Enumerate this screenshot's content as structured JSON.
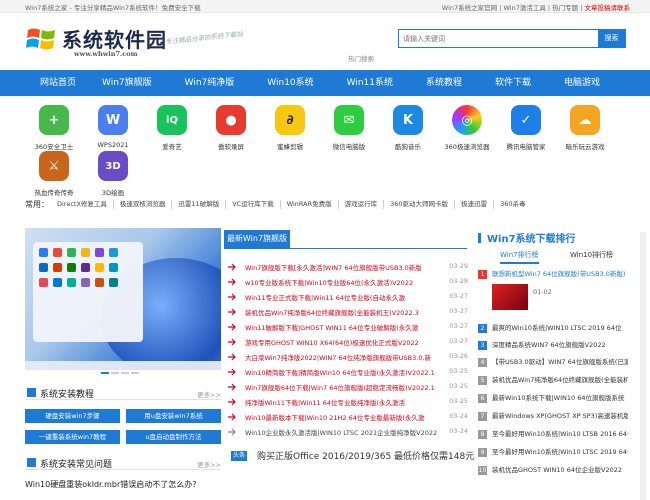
{
  "topbar": {
    "left": "Win7系统之家 - 专注分享精品Win7系统软件！免费安全下载",
    "right_links": [
      "Win7系统之家官网",
      "Win7激活工具",
      "热门专题"
    ],
    "right_red": "文章投稿请联系"
  },
  "logo": {
    "text": "系统软件园",
    "url": "www.whwin7.com",
    "slogan": "专注精品分享的系统下载站"
  },
  "search": {
    "placeholder": "请输入关键词",
    "button": "搜索",
    "hot_label": "热门搜索"
  },
  "nav": [
    "网站首页",
    "Win7旗舰版",
    "Win7纯净版",
    "Win10系统",
    "Win11系统",
    "系统教程",
    "软件下载",
    "电脑游戏"
  ],
  "apps": [
    {
      "name": "360安全卫士",
      "color": "#49b749",
      "glyph": "+"
    },
    {
      "name": "WPS2021",
      "color": "#4b7ff0",
      "glyph": "W"
    },
    {
      "name": "爱奇艺",
      "color": "#19c25a",
      "glyph": "iQ"
    },
    {
      "name": "傲软录屏",
      "color": "#e63b2e",
      "glyph": "●"
    },
    {
      "name": "蜜蜂剪辑",
      "color": "#f7c812",
      "glyph": "∂"
    },
    {
      "name": "微信电脑版",
      "color": "#2ecc40",
      "glyph": "✉"
    },
    {
      "name": "酷狗音乐",
      "color": "#1e88e5",
      "glyph": "K"
    },
    {
      "name": "360极速浏览器",
      "color": "#ff8a1c",
      "glyph": "◎"
    },
    {
      "name": "腾讯电脑管家",
      "color": "#1d7fe8",
      "glyph": "✓"
    },
    {
      "name": "暗乐玩云游戏",
      "color": "#f4a623",
      "glyph": "☁"
    },
    {
      "name": "热血传奇传奇",
      "color": "#c9641b",
      "glyph": "⚔"
    },
    {
      "name": "3D绘画",
      "color": "#6a4cc7",
      "glyph": "3D"
    }
  ],
  "tags": {
    "label": "常用：",
    "items": [
      "DirectX修复工具",
      "极速双核浏览器",
      "迅雷11破解版",
      "VC运行库下载",
      "WinRAR免费版",
      "游戏运行库",
      "360驱动大师网卡版",
      "极速迅雷",
      "360杀毒"
    ]
  },
  "install_section": {
    "title": "系统安装教程",
    "more": "更多>>",
    "buttons": [
      "硬盘安装win7步骤",
      "用u盘安装win7系统",
      "一键重装系统win7教程",
      "u盘启动盘制作方法"
    ]
  },
  "faq_section": {
    "title": "系统安装常见问题",
    "more": "更多>>",
    "first_item": "Win10硬盘重装okldr.mbr错误启动不了怎么办?"
  },
  "news": {
    "title": "最新Win7旗舰版",
    "items": [
      {
        "text": "Win7旗舰版下载[永久激活]WIN7 64位旗舰版带USB3.0新版",
        "date": "03-29",
        "red": true
      },
      {
        "text": "w10专业版系统下载|Win10专业版64位(永久激活)V2022",
        "date": "03-28",
        "red": true
      },
      {
        "text": "Win11专业正式版下载|Win11 64位专业版(自动永久激",
        "date": "03-27",
        "red": true
      },
      {
        "text": "装机优品Win7纯净版64位终藏旗舰版(全能装机王)V2022.3",
        "date": "03-27",
        "red": true
      },
      {
        "text": "Win11破解版下载|GHOST WIN11 64位专业破解版(永久激",
        "date": "03-27",
        "red": true
      },
      {
        "text": "游戏专用GHOST WIN10 X64(64位)极速优化正式版V2022",
        "date": "03-27",
        "red": true
      },
      {
        "text": "大白菜Win7纯净版2022|WIN7 64位纯净版旗舰版带USB3.0,新",
        "date": "03-26",
        "red": true
      },
      {
        "text": "Win10精简版下载|精简版Win10 64位专业版(永久激活)V2022.1",
        "date": "03-25",
        "red": true
      },
      {
        "text": "Win7旗舰版64位下载|Win7 64位旗舰版(超稳定流畅版)V2022.1",
        "date": "03-25",
        "red": true
      },
      {
        "text": "纯净版Win11下载|Win11 64位专业版纯净版(永久激活",
        "date": "03-25",
        "red": true
      },
      {
        "text": "Win10最新版本下载|Win10 21H2 64位专业版最新版(永久激",
        "date": "03-24",
        "red": true
      },
      {
        "text": "Win10企业版永久激活版|WIN10 LTSC 2021企业版纯净版V2022",
        "date": "03-24",
        "red": false
      }
    ]
  },
  "ad": {
    "label": "头条",
    "text": "购买正版Office 2016/2019/365 最低价格仅需148元"
  },
  "rank": {
    "title": "Win7系统下载排行",
    "tabs": [
      "Win7排行榜",
      "Win10排行榜"
    ],
    "thumb_label": "01-02",
    "items": [
      {
        "num": "1",
        "text": "联想新机型Win7 64位旗舰版(带USB3.0新版)"
      },
      {
        "num": "2",
        "text": "最爽的Win10系统|WIN10 LTSC 2019 64位"
      },
      {
        "num": "3",
        "text": "深度精品系统WIN7 64位旗舰版V2022"
      },
      {
        "num": "4",
        "text": "【带USB3.0驱动】WIN7 64位旗舰版系统(已激活)"
      },
      {
        "num": "5",
        "text": "装机优品Win7纯净版64位终藏旗舰版(全能装机王)"
      },
      {
        "num": "6",
        "text": "最新Win10系统下载|WIN10 64位旗舰版系统"
      },
      {
        "num": "7",
        "text": "最新Windows XP(GHOST XP SP3)高速装机版"
      },
      {
        "num": "8",
        "text": "至今最好用Win10系统|Win10 LTSB 2016 64位"
      },
      {
        "num": "9",
        "text": "至今最好用Win10系统|Win10 LTSC 2019 64位"
      },
      {
        "num": "10",
        "text": "装机优品GHOST WIN10 64位企业版V2022"
      }
    ]
  }
}
